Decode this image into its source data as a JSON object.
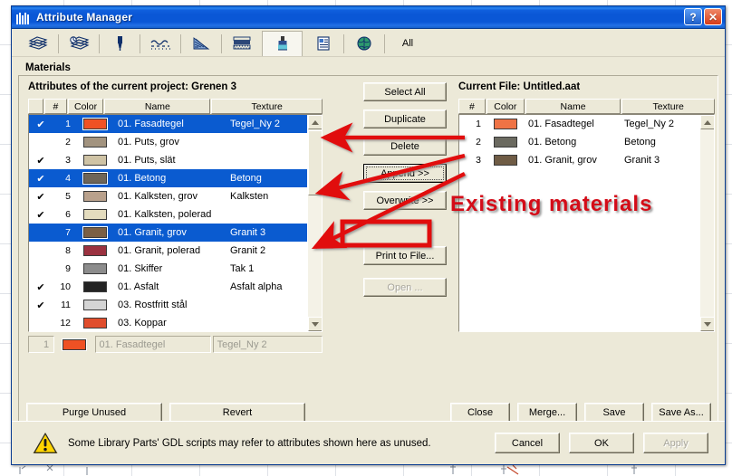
{
  "window": {
    "title": "Attribute Manager",
    "icon": "attribute-manager-icon",
    "help_label": "?",
    "close_label": "✕"
  },
  "toolbar": {
    "all_label": "All",
    "items": [
      {
        "name": "layers-icon",
        "active": false
      },
      {
        "name": "layer-combinations-icon",
        "active": false
      },
      {
        "name": "pen-icon",
        "active": false
      },
      {
        "name": "line-types-icon",
        "active": false
      },
      {
        "name": "fill-types-icon",
        "active": false
      },
      {
        "name": "composites-icon",
        "active": false
      },
      {
        "name": "materials-icon",
        "active": true
      },
      {
        "name": "zone-categories-icon",
        "active": false
      },
      {
        "name": "cities-icon",
        "active": false
      }
    ]
  },
  "panel": {
    "label": "Materials"
  },
  "left_list": {
    "title": "Attributes of the current project: Grenen 3",
    "columns": [
      "",
      "#",
      "Color",
      "Name",
      "Texture"
    ],
    "rows": [
      {
        "checked": true,
        "num": "1",
        "color": "#ef5124",
        "name": "01. Fasadtegel",
        "texture": "Tegel_Ny 2",
        "selected": true
      },
      {
        "checked": false,
        "num": "2",
        "color": "#a2937f",
        "name": "01. Puts, grov",
        "texture": "",
        "selected": false
      },
      {
        "checked": true,
        "num": "3",
        "color": "#cfc3a5",
        "name": "01. Puts, slät",
        "texture": "",
        "selected": false
      },
      {
        "checked": true,
        "num": "4",
        "color": "#6e6558",
        "name": "01. Betong",
        "texture": "Betong",
        "selected": true
      },
      {
        "checked": true,
        "num": "5",
        "color": "#b9a18c",
        "name": "01. Kalksten, grov",
        "texture": "Kalksten",
        "selected": false
      },
      {
        "checked": true,
        "num": "6",
        "color": "#e4dcbe",
        "name": "01. Kalksten, polerad",
        "texture": "",
        "selected": false
      },
      {
        "checked": false,
        "num": "7",
        "color": "#7b5f43",
        "name": "01. Granit, grov",
        "texture": "Granit 3",
        "selected": true
      },
      {
        "checked": false,
        "num": "8",
        "color": "#9b3240",
        "name": "01. Granit, polerad",
        "texture": "Granit 2",
        "selected": false
      },
      {
        "checked": false,
        "num": "9",
        "color": "#8c8c8c",
        "name": "01. Skiffer",
        "texture": "Tak 1",
        "selected": false
      },
      {
        "checked": true,
        "num": "10",
        "color": "#232323",
        "name": "01. Asfalt",
        "texture": "Asfalt alpha",
        "selected": false
      },
      {
        "checked": true,
        "num": "11",
        "color": "#d4d4d4",
        "name": "03. Rostfritt stål",
        "texture": "",
        "selected": false
      },
      {
        "checked": false,
        "num": "12",
        "color": "#e04d2c",
        "name": "03. Koppar",
        "texture": "",
        "selected": false
      }
    ],
    "edit_row": {
      "num": "1",
      "color": "#ef5124",
      "name": "01. Fasadtegel",
      "texture": "Tegel_Ny 2"
    }
  },
  "right_list": {
    "title": "Current File: Untitled.aat",
    "columns": [
      "#",
      "Color",
      "Name",
      "Texture"
    ],
    "rows": [
      {
        "num": "1",
        "color": "#ef7345",
        "name": "01. Fasadtegel",
        "texture": "Tegel_Ny 2"
      },
      {
        "num": "2",
        "color": "#6b6a60",
        "name": "01. Betong",
        "texture": "Betong"
      },
      {
        "num": "3",
        "color": "#6f5c45",
        "name": "01. Granit, grov",
        "texture": "Granit 3"
      }
    ]
  },
  "middle_buttons": [
    {
      "label": "Select All",
      "name": "select-all-button",
      "disabled": false,
      "default": false
    },
    {
      "label": "Duplicate",
      "name": "duplicate-button",
      "disabled": false,
      "default": false
    },
    {
      "label": "Delete",
      "name": "delete-button",
      "disabled": false,
      "default": false
    },
    {
      "label": "Append >>",
      "name": "append-button",
      "disabled": false,
      "default": true
    },
    {
      "label": "Overwrite >>",
      "name": "overwrite-button",
      "disabled": false,
      "default": false
    },
    {
      "label": "Print to File...",
      "name": "print-to-file-button",
      "disabled": false,
      "default": false
    },
    {
      "label": "Open ...",
      "name": "open-button",
      "disabled": true,
      "default": false
    }
  ],
  "left_bottom_buttons": [
    {
      "label": "Purge Unused",
      "name": "purge-unused-button"
    },
    {
      "label": "Revert",
      "name": "revert-button"
    }
  ],
  "right_bottom_buttons": [
    {
      "label": "Close",
      "name": "close-file-button"
    },
    {
      "label": "Merge...",
      "name": "merge-button"
    },
    {
      "label": "Save",
      "name": "save-button"
    },
    {
      "label": "Save As...",
      "name": "save-as-button"
    }
  ],
  "status": {
    "icon": "warning-icon",
    "message": "Some Library Parts' GDL scripts may refer to attributes shown here as unused.",
    "buttons": [
      {
        "label": "Cancel",
        "name": "cancel-button",
        "disabled": false
      },
      {
        "label": "OK",
        "name": "ok-button",
        "disabled": false
      },
      {
        "label": "Apply",
        "name": "apply-button",
        "disabled": true
      }
    ]
  },
  "annotation": {
    "text": "Existing materials",
    "color": "#d40c18"
  }
}
